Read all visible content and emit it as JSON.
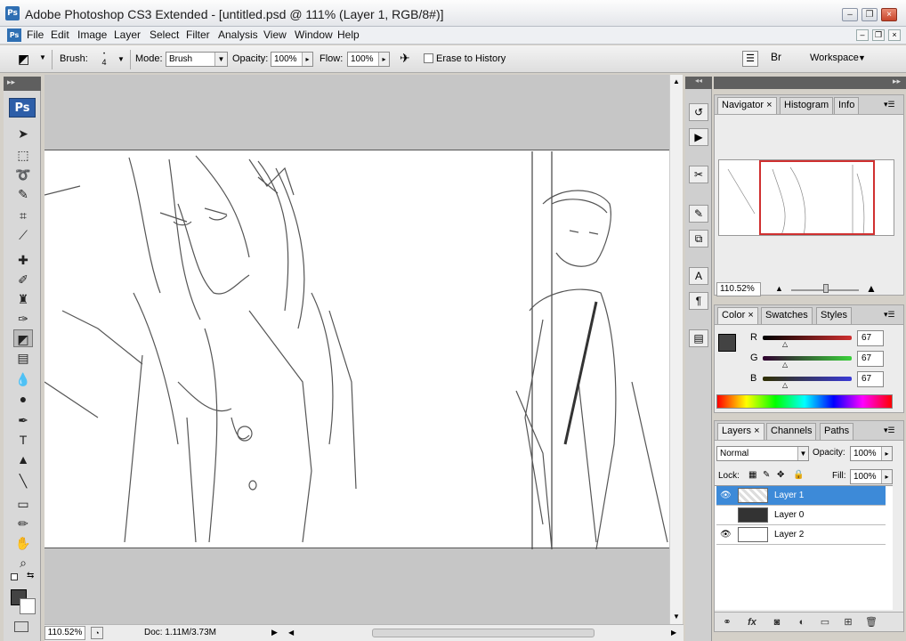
{
  "window": {
    "title": "Adobe Photoshop CS3 Extended - [untitled.psd @ 111% (Layer 1, RGB/8#)]",
    "app_icon": "Ps",
    "minimize": "–",
    "restore": "❐",
    "close": "×"
  },
  "menu": {
    "app_icon": "Ps",
    "items": [
      "File",
      "Edit",
      "Image",
      "Layer",
      "Select",
      "Filter",
      "Analysis",
      "View",
      "Window",
      "Help"
    ]
  },
  "options": {
    "brush_label": "Brush:",
    "brush_size": "4",
    "mode_label": "Mode:",
    "mode_value": "Brush",
    "opacity_label": "Opacity:",
    "opacity_value": "100%",
    "flow_label": "Flow:",
    "flow_value": "100%",
    "erase_history_label": "Erase to History",
    "workspace_label": "Workspace"
  },
  "tools": {
    "ps_logo": "Ps",
    "items": [
      {
        "name": "move-tool-icon",
        "glyph": "➤"
      },
      {
        "name": "marquee-tool-icon",
        "glyph": "⬚"
      },
      {
        "name": "lasso-tool-icon",
        "glyph": "➰"
      },
      {
        "name": "quick-select-tool-icon",
        "glyph": "✎"
      },
      {
        "name": "crop-tool-icon",
        "glyph": "⌗"
      },
      {
        "name": "slice-tool-icon",
        "glyph": "⟋"
      },
      {
        "name": "healing-brush-tool-icon",
        "glyph": "✚"
      },
      {
        "name": "brush-tool-icon",
        "glyph": "✐"
      },
      {
        "name": "clone-stamp-tool-icon",
        "glyph": "♜"
      },
      {
        "name": "history-brush-tool-icon",
        "glyph": "✑"
      },
      {
        "name": "eraser-tool-icon",
        "glyph": "◩"
      },
      {
        "name": "gradient-tool-icon",
        "glyph": "▤"
      },
      {
        "name": "blur-tool-icon",
        "glyph": "💧"
      },
      {
        "name": "dodge-tool-icon",
        "glyph": "●"
      },
      {
        "name": "pen-tool-icon",
        "glyph": "✒"
      },
      {
        "name": "type-tool-icon",
        "glyph": "T"
      },
      {
        "name": "path-select-tool-icon",
        "glyph": "▲"
      },
      {
        "name": "line-tool-icon",
        "glyph": "╲"
      },
      {
        "name": "notes-tool-icon",
        "glyph": "▭"
      },
      {
        "name": "eyedropper-tool-icon",
        "glyph": "✏"
      },
      {
        "name": "hand-tool-icon",
        "glyph": "✋"
      },
      {
        "name": "zoom-tool-icon",
        "glyph": "⌕"
      }
    ]
  },
  "status": {
    "zoom": "110.52%",
    "doc": "Doc: 1.11M/3.73M"
  },
  "navigator": {
    "tabs": [
      "Navigator",
      "Histogram",
      "Info"
    ],
    "zoom": "110.52%"
  },
  "color": {
    "tabs": [
      "Color",
      "Swatches",
      "Styles"
    ],
    "r_label": "R",
    "g_label": "G",
    "b_label": "B",
    "r": "67",
    "g": "67",
    "b": "67",
    "fg_color": "#434343"
  },
  "layers": {
    "tabs": [
      "Layers",
      "Channels",
      "Paths"
    ],
    "blend_mode": "Normal",
    "opacity_label": "Opacity:",
    "opacity": "100%",
    "lock_label": "Lock:",
    "fill_label": "Fill:",
    "fill": "100%",
    "items": [
      {
        "name": "Layer 1",
        "visible": true,
        "selected": true
      },
      {
        "name": "Layer 0",
        "visible": false,
        "selected": false
      },
      {
        "name": "Layer 2",
        "visible": true,
        "selected": false
      }
    ]
  },
  "colors": {
    "selection_blue": "#3d8ad8",
    "nav_frame_red": "#d03030"
  }
}
